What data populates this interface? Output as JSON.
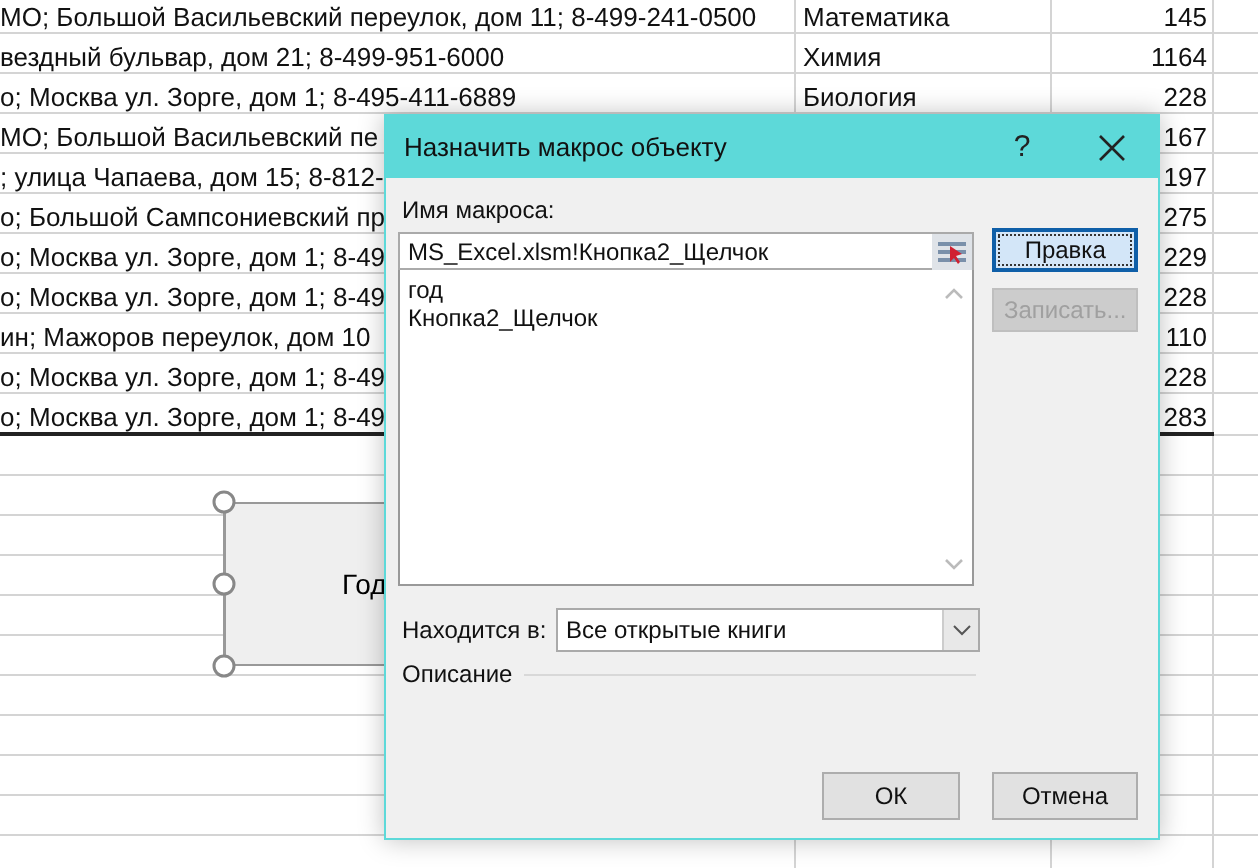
{
  "sheet": {
    "rows": [
      {
        "address": "МО; Большой Васильевский переулок, дом 11; 8-499-241-0500",
        "subject": "Математика",
        "count": "145",
        "bottom_border": false
      },
      {
        "address": "вездный бульвар, дом 21; 8-499-951-6000",
        "subject": "Химия",
        "count": "1164",
        "bottom_border": false
      },
      {
        "address": "о; Москва ул. Зорге, дом 1; 8-495-411-6889",
        "subject": "Биология",
        "count": "228",
        "bottom_border": false
      },
      {
        "address": "МО; Большой Васильевский пе",
        "count": "167",
        "bottom_border": false
      },
      {
        "address": "; улица Чапаева, дом 15; 8-812-",
        "count": "197",
        "bottom_border": false
      },
      {
        "address": "о; Большой Сампсониевский пр",
        "count": "275",
        "bottom_border": false
      },
      {
        "address": "о; Москва ул. Зорге, дом 1; 8-49",
        "count": "229",
        "bottom_border": false
      },
      {
        "address": "о; Москва ул. Зорге, дом 1; 8-49",
        "count": "228",
        "bottom_border": false
      },
      {
        "address": "ин; Мажоров переулок, дом 10",
        "count": "110",
        "bottom_border": false
      },
      {
        "address": "о; Москва ул. Зорге, дом 1; 8-49",
        "count": "228",
        "bottom_border": false
      },
      {
        "address": "о; Москва ул. Зорге, дом 1; 8-49",
        "count": "283",
        "bottom_border": true
      }
    ]
  },
  "shape": {
    "label": "Год",
    "selected": true
  },
  "dialog": {
    "title": "Назначить макрос объекту",
    "help": "?",
    "macro_name_label": "Имя макроса:",
    "macro_name_value": "MS_Excel.xlsm!Кнопка2_Щелчок",
    "macros": [
      {
        "name": "год"
      },
      {
        "name": "Кнопка2_Щелчок"
      }
    ],
    "side_buttons": [
      {
        "label": "Правка",
        "focused": true,
        "disabled": false
      },
      {
        "label": "Записать...",
        "focused": false,
        "disabled": true
      }
    ],
    "location_label": "Находится в:",
    "location_value": "Все открытые книги",
    "description_label": "Описание",
    "buttons": [
      {
        "label": "ОК"
      },
      {
        "label": "Отмена"
      }
    ]
  }
}
